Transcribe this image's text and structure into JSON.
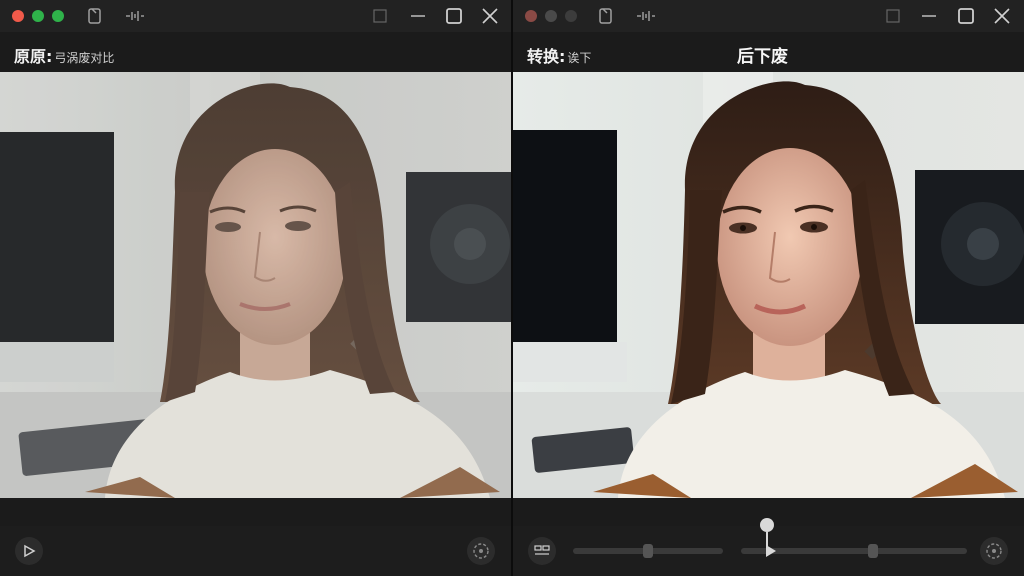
{
  "colors": {
    "traffic_red": "#f05a4a",
    "traffic_yellow": "#2fb24a",
    "traffic_green": "#2fb24a",
    "dim_dot": "#6a3a3a",
    "background": "#1b1b1b",
    "accent_slider": "#d9d9d9"
  },
  "left": {
    "title_main": "原原:",
    "title_sub": "弓涡废对比",
    "icons": [
      "red-dot",
      "green-dot",
      "green-dot",
      "device-icon",
      "waveform-icon",
      "minimize-icon",
      "maximize-icon",
      "close-icon",
      "play-icon",
      "refresh-icon"
    ]
  },
  "right": {
    "title_main": "转换:",
    "title_sub": "诶下",
    "center_title": "后下废",
    "icons": [
      "device-icon",
      "waveform-icon",
      "minimize-icon",
      "maximize-icon",
      "close-icon",
      "compare-icon",
      "refresh-icon"
    ]
  },
  "slider": {
    "position_fraction": 0.05
  }
}
